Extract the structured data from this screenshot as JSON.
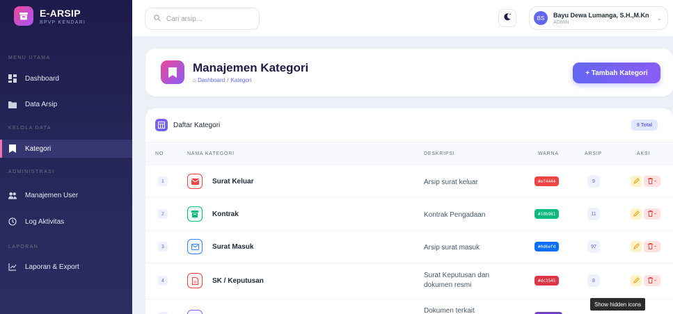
{
  "brand": {
    "name": "E-ARSIP",
    "subtitle": "BPVP KENDARI"
  },
  "sidebar": {
    "sections": [
      {
        "title": "MENU UTAMA"
      },
      {
        "title": "KELOLA DATA"
      },
      {
        "title": "ADMINISTRASI"
      },
      {
        "title": "LAPORAN"
      }
    ],
    "items": [
      {
        "label": "Dashboard",
        "icon": "grid-icon"
      },
      {
        "label": "Data Arsip",
        "icon": "folder-icon"
      },
      {
        "label": "Kategori",
        "icon": "bookmark-icon",
        "active": true
      },
      {
        "label": "Manajemen User",
        "icon": "users-icon"
      },
      {
        "label": "Log Aktivitas",
        "icon": "clock-icon"
      },
      {
        "label": "Laporan & Export",
        "icon": "chart-line-icon"
      }
    ]
  },
  "topbar": {
    "search_placeholder": "Cari arsip...",
    "user": {
      "initials": "BS",
      "name": "Bayu Dewa Lumanga, S.H.,M.Kn",
      "role": "ADMIN"
    }
  },
  "page": {
    "title": "Manajemen Kategori",
    "breadcrumb": {
      "home": "Dashboard",
      "separator": "/",
      "current": "Kategori"
    },
    "add_button": "+ Tambah Kategori"
  },
  "list": {
    "title": "Daftar Kategori",
    "total": "9 Total",
    "columns": [
      "NO",
      "NAMA KATEGORI",
      "DESKRIPSI",
      "WARNA",
      "ARSIP",
      "AKSI"
    ],
    "rows": [
      {
        "no": "1",
        "name": "Surat Keluar",
        "desc": "Arsip surat keluar",
        "color": "#ef4444",
        "count": "9",
        "icon": "envelope-icon"
      },
      {
        "no": "2",
        "name": "Kontrak",
        "desc": "Kontrak Pengadaan",
        "color": "#10b981",
        "count": "11",
        "icon": "archive-icon"
      },
      {
        "no": "3",
        "name": "Surat Masuk",
        "desc": "Arsip surat masuk",
        "color": "#0d6efd",
        "count": "97",
        "icon": "envelope-open-icon"
      },
      {
        "no": "4",
        "name": "SK / Keputusan",
        "desc": "Surat Keputusan dan dokumen resmi",
        "color": "#dc3545",
        "count": "8",
        "icon": "file-icon"
      },
      {
        "no": "",
        "name": "",
        "desc": "Dokumen terkait",
        "color": "#6f42c1",
        "count": "",
        "icon": "file-icon"
      }
    ]
  },
  "tooltip": "Show hidden icons"
}
